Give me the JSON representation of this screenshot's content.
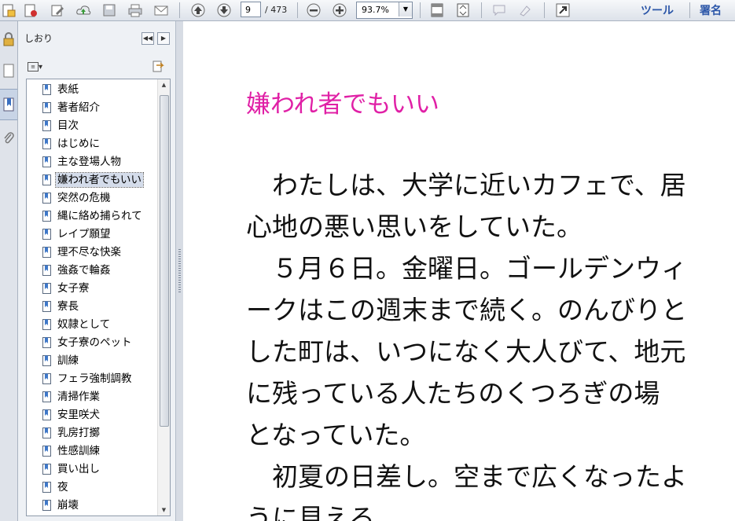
{
  "toolbar": {
    "page_current": "9",
    "page_total": "/ 473",
    "zoom": "93.7%",
    "tools_label": "ツール",
    "sign_label": "署名"
  },
  "panel": {
    "title": "しおり",
    "bookmarks": [
      "表紙",
      "著者紹介",
      "目次",
      "はじめに",
      "主な登場人物",
      "嫌われ者でもいい",
      "突然の危機",
      "縄に絡め捕られて",
      "レイプ願望",
      "理不尽な快楽",
      "強姦で輪姦",
      "女子寮",
      "寮長",
      "奴隷として",
      "女子寮のペット",
      "訓練",
      "フェラ強制調教",
      "清掃作業",
      "安里咲犬",
      "乳房打擲",
      "性感訓練",
      "買い出し",
      "夜",
      "崩壊"
    ],
    "selected_index": 5
  },
  "document": {
    "heading": "嫌われ者でもいい",
    "lines": [
      "　わたしは、大学に近いカフェで、居",
      "心地の悪い思いをしていた。",
      "　５月６日。金曜日。ゴールデンウィ",
      "ークはこの週末まで続く。のんびりと",
      "した町は、いつになく大人びて、地元",
      "に残っている人たちのくつろぎの場",
      "となっていた。",
      "　初夏の日差し。空まで広くなったよ",
      "うに見える。"
    ]
  },
  "colors": {
    "heading": "#e020a6",
    "accent": "#2b56a8"
  }
}
